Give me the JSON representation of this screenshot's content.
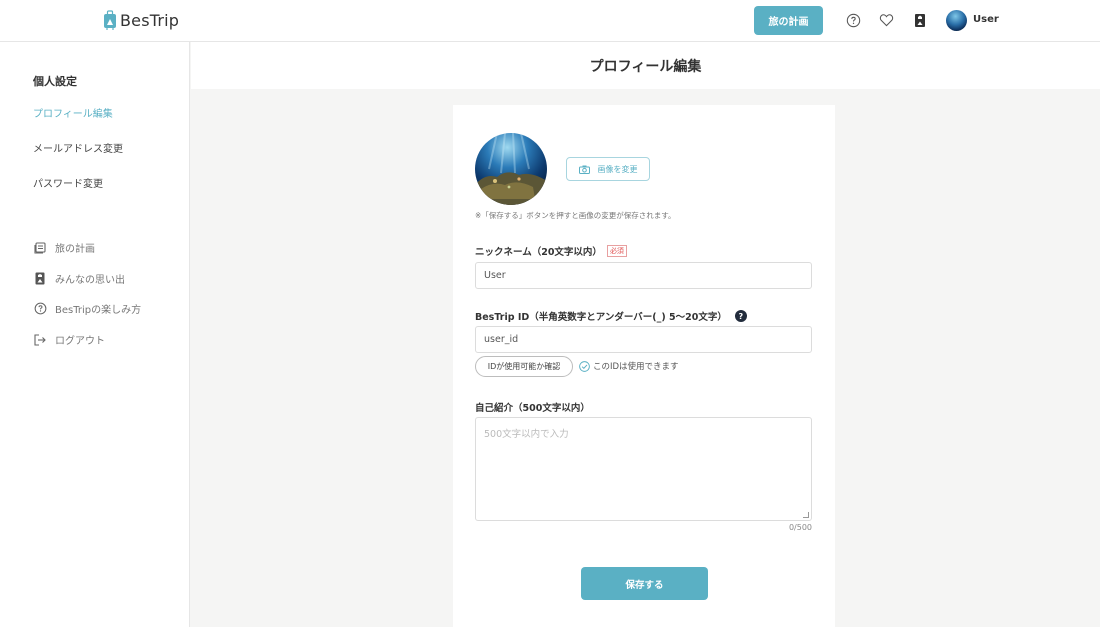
{
  "header": {
    "logo_text": "BesTrip",
    "plan_button": "旅の計画",
    "icons": [
      "help-icon",
      "heart-icon",
      "bookmark-icon"
    ],
    "user_name": "User"
  },
  "sidebar": {
    "section_title": "個人設定",
    "settings_links": [
      {
        "label": "プロフィール編集",
        "active": true
      },
      {
        "label": "メールアドレス変更",
        "active": false
      },
      {
        "label": "パスワード変更",
        "active": false
      }
    ],
    "nav_items": [
      {
        "label": "旅の計画",
        "icon": "list-icon"
      },
      {
        "label": "みんなの思い出",
        "icon": "photo-album-icon"
      },
      {
        "label": "BesTripの楽しみ方",
        "icon": "help-icon"
      },
      {
        "label": "ログアウト",
        "icon": "logout-icon"
      }
    ]
  },
  "main": {
    "page_title": "プロフィール編集",
    "profile_image_button": "画像を変更",
    "profile_image_note": "※「保存する」ボタンを押すと画像の変更が保存されます。",
    "nickname": {
      "label": "ニックネーム（20文字以内）",
      "required_badge": "必須",
      "value": "User"
    },
    "bestrip_id": {
      "label": "BesTrip ID（半角英数字とアンダーバー(_) 5〜20文字）",
      "help": "?",
      "value": "user_id",
      "check_button": "IDが使用可能か確認",
      "check_status": "このIDは使用できます"
    },
    "bio": {
      "label": "自己紹介（500文字以内）",
      "placeholder": "500文字以内で入力",
      "counter": "0/500"
    },
    "save_button": "保存する"
  },
  "colors": {
    "accent": "#5ab0c4",
    "required": "#e05050",
    "background": "#f5f5f4"
  }
}
